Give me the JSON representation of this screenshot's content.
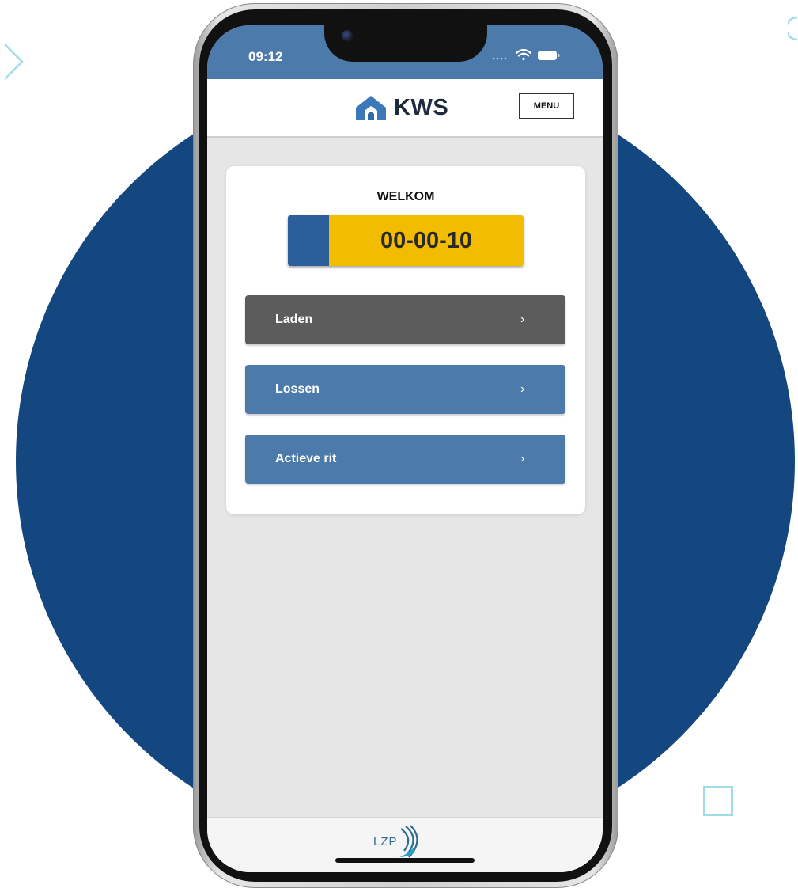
{
  "status_bar": {
    "time": "09:12"
  },
  "header": {
    "logo_text": "KWS",
    "menu_label": "MENU"
  },
  "card": {
    "welcome": "WELKOM",
    "plate": "00-00-10",
    "actions": [
      {
        "label": "Laden",
        "chevron": "›",
        "color": "#5c5c5c"
      },
      {
        "label": "Lossen",
        "chevron": "›",
        "color": "#4b7aab"
      },
      {
        "label": "Actieve rit",
        "chevron": "›",
        "color": "#4b7aab"
      }
    ]
  },
  "footer": {
    "logo_text": "LZP"
  },
  "colors": {
    "background_circle": "#14477f",
    "status_bar": "#4b7aab",
    "plate_yellow": "#f2bd00",
    "plate_blue": "#2b5f9c"
  },
  "icons": [
    "wifi-icon",
    "battery-icon",
    "signal-dots-icon",
    "kws-logo-icon",
    "chevron-right-icon",
    "lzp-logo-icon"
  ]
}
